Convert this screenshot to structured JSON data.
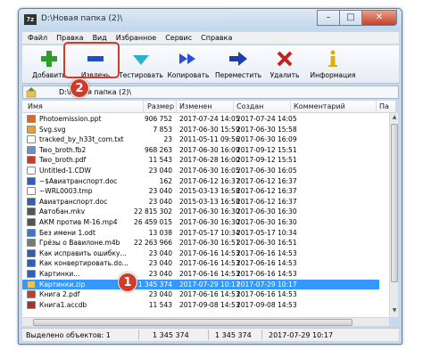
{
  "window": {
    "title": "D:\\Новая папка (2)\\",
    "app_icon": "7z",
    "controls": {
      "minimize": "–",
      "maximize": "□",
      "close": "✕"
    }
  },
  "menu": [
    "Файл",
    "Правка",
    "Вид",
    "Избранное",
    "Сервис",
    "Справка"
  ],
  "toolbar": [
    {
      "label": "Добавить",
      "icon": "plus-icon",
      "color": "#2e9e2e"
    },
    {
      "label": "Извлечь",
      "icon": "minus-icon",
      "color": "#1f4fc2"
    },
    {
      "label": "Тестировать",
      "icon": "check-icon",
      "color": "#2bb2c8"
    },
    {
      "label": "Копировать",
      "icon": "double-arrow-icon",
      "color": "#2b4fd6"
    },
    {
      "label": "Переместить",
      "icon": "arrow-right-icon",
      "color": "#1f3da8"
    },
    {
      "label": "Удалить",
      "icon": "x-icon",
      "color": "#c42020"
    },
    {
      "label": "Информация",
      "icon": "info-icon",
      "color": "#d8b010"
    }
  ],
  "address": {
    "path": "D:\\Новая папка (2)\\"
  },
  "columns": [
    "Имя",
    "Размер",
    "Изменен",
    "Создан",
    "Комментарий",
    "Па"
  ],
  "files": [
    {
      "name": "Photoemission.ppt",
      "size": "906 752",
      "modified": "2017-07-24 14:05",
      "created": "2017-07-24 14:05",
      "icon": "ppt-icon"
    },
    {
      "name": "Svg.svg",
      "size": "7 853",
      "modified": "2017-06-30 15:59",
      "created": "2017-06-30 15:58",
      "icon": "svg-icon"
    },
    {
      "name": "tracked_by_h33t_com.txt",
      "size": "23",
      "modified": "2011-05-11 09:56",
      "created": "2017-06-30 16:09",
      "icon": "txt-icon"
    },
    {
      "name": "Two_broth.fb2",
      "size": "968 263",
      "modified": "2017-06-30 16:09",
      "created": "2017-09-12 15:51",
      "icon": "fb2-icon"
    },
    {
      "name": "Two_broth.pdf",
      "size": "11 543",
      "modified": "2017-06-28 16:00",
      "created": "2017-09-12 15:51",
      "icon": "pdf-icon"
    },
    {
      "name": "Untitled-1.CDW",
      "size": "23 040",
      "modified": "2017-06-30 16:05",
      "created": "2017-06-30 16:05",
      "icon": "cdw-icon"
    },
    {
      "name": "~$Авиатранспорт.doc",
      "size": "162",
      "modified": "2017-06-12 16:37",
      "created": "2017-06-12 16:37",
      "icon": "doc-icon"
    },
    {
      "name": "~WRL0003.tmp",
      "size": "23 040",
      "modified": "2015-03-13 16:58",
      "created": "2017-06-12 16:37",
      "icon": "tmp-icon"
    },
    {
      "name": "Авиатранспорт.doc",
      "size": "23 040",
      "modified": "2015-03-13 16:58",
      "created": "2017-06-12 16:37",
      "icon": "doc-icon"
    },
    {
      "name": "Автобан.mkv",
      "size": "22 815 302",
      "modified": "2017-06-30 16:30",
      "created": "2017-06-30 16:30",
      "icon": "video-icon"
    },
    {
      "name": "АКМ против М-16.mp4",
      "size": "26 459 015",
      "modified": "2017-06-30 16:30",
      "created": "2017-06-30 16:30",
      "icon": "video-icon"
    },
    {
      "name": "Без имени 1.odt",
      "size": "13 038",
      "modified": "2017-05-17 10:34",
      "created": "2017-05-17 10:34",
      "icon": "odt-icon"
    },
    {
      "name": "Грёзы о Вавилоне.m4b",
      "size": "22 263 966",
      "modified": "2017-06-30 16:51",
      "created": "2017-06-30 16:51",
      "icon": "audio-icon"
    },
    {
      "name": "Как исправить ошибку...",
      "size": "23 040",
      "modified": "2017-06-16 14:53",
      "created": "2017-06-16 14:53",
      "icon": "doc-icon"
    },
    {
      "name": "Как конвертировать.do...",
      "size": "23 040",
      "modified": "2017-06-16 14:53",
      "created": "2017-06-16 14:53",
      "icon": "doc-icon"
    },
    {
      "name": "Картинки...",
      "size": "23 040",
      "modified": "2017-06-16 14:53",
      "created": "2017-06-16 14:53",
      "icon": "doc-icon"
    },
    {
      "name": "Картинки.zip",
      "size": "1 345 374",
      "modified": "2017-07-29 10:17",
      "created": "2017-07-29 10:17",
      "icon": "zip-icon",
      "selected": true
    },
    {
      "name": "Книга 2.pdf",
      "size": "23 040",
      "modified": "2017-06-16 14:53",
      "created": "2017-06-16 14:53",
      "icon": "pdf-icon"
    },
    {
      "name": "Книга1.accdb",
      "size": "11 543",
      "modified": "2017-09-08 14:53",
      "created": "2017-09-08 14:53",
      "icon": "accdb-icon"
    }
  ],
  "status": {
    "selected": "Выделено объектов: 1",
    "size": "1 345 374",
    "size2": "1 345 374",
    "modified": "2017-07-29 10:17"
  },
  "callouts": {
    "one": "1",
    "two": "2"
  },
  "colors": {
    "highlight": "#d23b2a",
    "selection": "#3399ff"
  }
}
